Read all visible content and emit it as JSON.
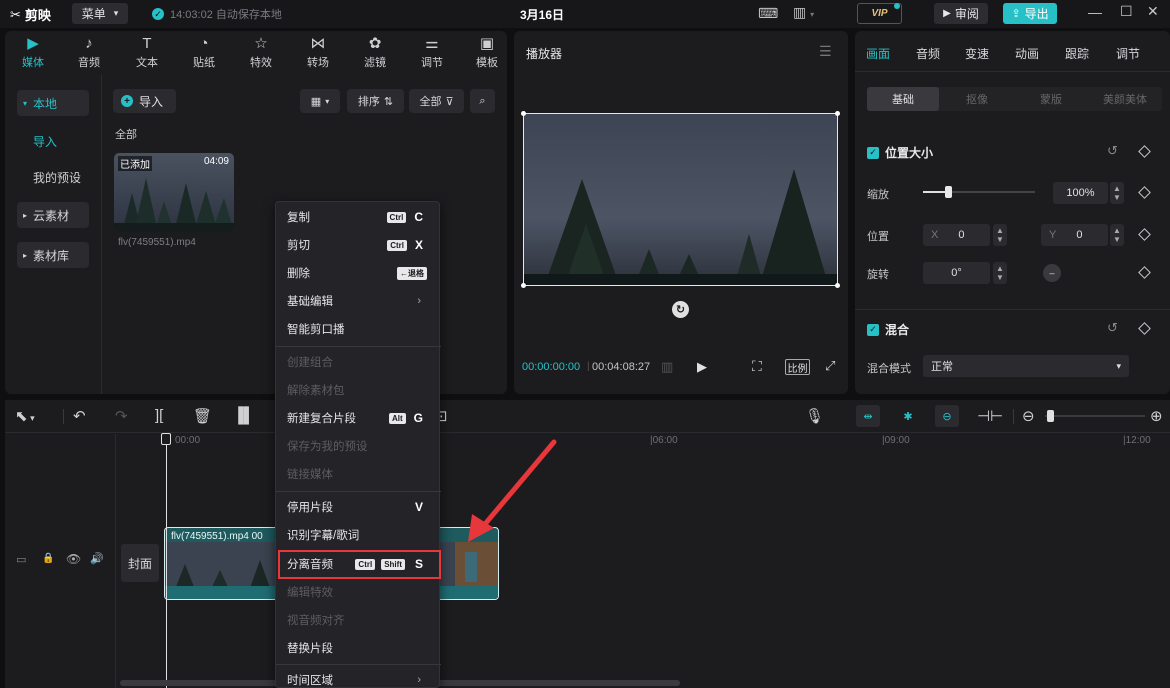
{
  "app": {
    "logo": "剪映",
    "menu": "菜单",
    "autosave": "14:03:02 自动保存本地",
    "title": "3月16日",
    "vip": "VIP",
    "review": "审阅",
    "export": "导出"
  },
  "media": {
    "tabs": [
      {
        "label": "媒体",
        "icon": "media-icon"
      },
      {
        "label": "音频",
        "icon": "audio-icon"
      },
      {
        "label": "文本",
        "icon": "text-icon"
      },
      {
        "label": "贴纸",
        "icon": "sticker-icon"
      },
      {
        "label": "特效",
        "icon": "effects-icon"
      },
      {
        "label": "转场",
        "icon": "transition-icon"
      },
      {
        "label": "滤镜",
        "icon": "filter-icon"
      },
      {
        "label": "调节",
        "icon": "adjust-icon"
      },
      {
        "label": "模板",
        "icon": "template-icon"
      }
    ],
    "sidebar": {
      "local": "本地",
      "import": "导入",
      "presets": "我的预设",
      "cloud": "云素材",
      "library": "素材库"
    },
    "import_btn": "导入",
    "sort": "排序",
    "filter": "全部",
    "all_label": "全部",
    "clip": {
      "tag": "已添加",
      "duration": "04:09",
      "name": "flv(7459551).mp4"
    }
  },
  "player": {
    "title": "播放器",
    "current": "00:00:00:00",
    "total": "00:04:08:27",
    "ratio": "比例"
  },
  "props": {
    "tabs": [
      "画面",
      "音频",
      "变速",
      "动画",
      "跟踪",
      "调节"
    ],
    "subtabs": [
      "基础",
      "抠像",
      "蒙版",
      "美颜美体"
    ],
    "position_size": "位置大小",
    "scale_label": "缩放",
    "scale_value": 100,
    "scale_text": "100%",
    "position_label": "位置",
    "x_label": "X",
    "x_value": "0",
    "y_label": "Y",
    "y_value": "0",
    "rotate_label": "旋转",
    "rotate_value": "0°",
    "blend": "混合",
    "blend_mode_label": "混合模式",
    "blend_mode_value": "正常"
  },
  "timeline": {
    "ticks": [
      "00:00",
      "06:00",
      "09:00",
      "12:00"
    ],
    "cover": "封面",
    "clip_label": "flv(7459551).mp4  00"
  },
  "context_menu": {
    "copy": {
      "label": "复制",
      "mod": "Ctrl",
      "key": "C"
    },
    "cut": {
      "label": "剪切",
      "mod": "Ctrl",
      "key": "X"
    },
    "delete": {
      "label": "删除",
      "mod": "←退格"
    },
    "basic_edit": "基础编辑",
    "smart_crop": "智能剪口播",
    "create_group": "创建组合",
    "ungroup": "解除素材包",
    "new_compound": {
      "label": "新建复合片段",
      "mod": "Alt",
      "key": "G"
    },
    "save_preset": "保存为我的预设",
    "link_media": "链接媒体",
    "disable_clip": {
      "label": "停用片段",
      "key": "V"
    },
    "recognize": "识别字幕/歌词",
    "separate_audio": {
      "label": "分离音频",
      "mod1": "Ctrl",
      "mod2": "Shift",
      "key": "S"
    },
    "edit_effects": "编辑特效",
    "audio_video_align": "视音频对齐",
    "replace_clip": "替换片段",
    "time_range": "时间区域"
  }
}
